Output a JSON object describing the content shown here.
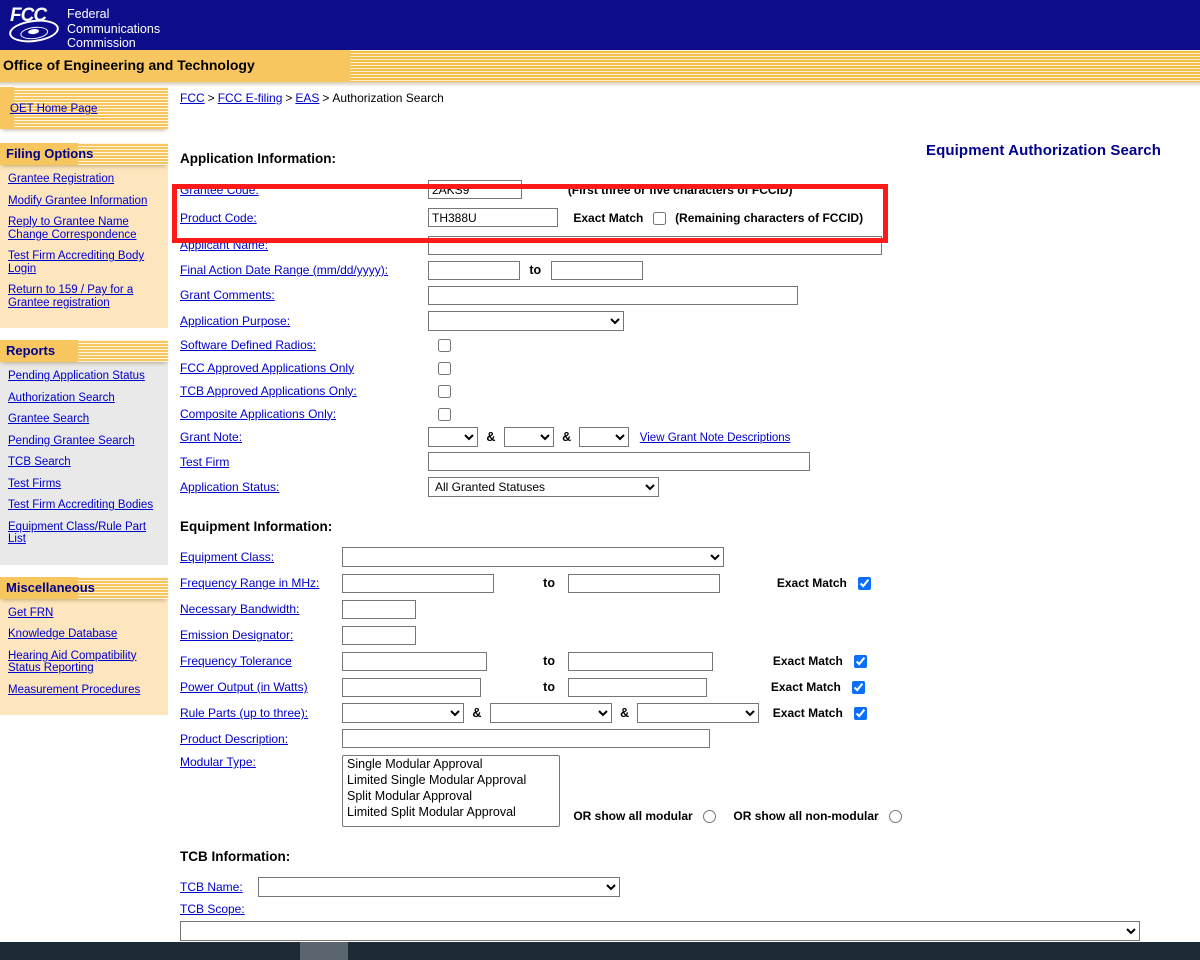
{
  "header": {
    "agency_abbr": "FCC",
    "agency_name_lines": "Federal\nCommunications\nCommission",
    "agency_line1": "Federal",
    "agency_line2": "Communications",
    "agency_line3": "Commission",
    "office_title": "Office of Engineering and Technology"
  },
  "breadcrumb": {
    "items": [
      "FCC",
      "FCC E-filing",
      "EAS"
    ],
    "current": "Authorization Search",
    "separator": ">"
  },
  "page_title": "Equipment Authorization Search",
  "sidebar": {
    "home_link": "OET Home Page",
    "panels": [
      {
        "title": "Filing Options",
        "style": "cream",
        "items": [
          "Grantee Registration",
          "Modify Grantee Information",
          "Reply to Grantee Name Change Correspondence",
          "Test Firm Accrediting Body Login",
          "Return to 159 / Pay for a Grantee registration"
        ]
      },
      {
        "title": "Reports",
        "style": "gray",
        "items": [
          "Pending Application Status",
          "Authorization Search",
          "Grantee Search",
          "Pending Grantee Search",
          "TCB Search",
          "Test Firms",
          "Test Firm Accrediting Bodies",
          "Equipment Class/Rule Part List"
        ]
      },
      {
        "title": "Miscellaneous",
        "style": "cream",
        "items": [
          "Get FRN",
          "Knowledge Database",
          "Hearing Aid Compatibility Status Reporting",
          "Measurement Procedures"
        ]
      }
    ]
  },
  "application_information": {
    "section_label": "Application Information:",
    "grantee_code": {
      "label": "Grantee Code:",
      "value": "2AKS9",
      "hint": "(First three or five characters of FCCID)"
    },
    "product_code": {
      "label": "Product Code:",
      "value": "TH388U",
      "exact_match_label": "Exact Match",
      "exact_match_checked": false,
      "hint": "(Remaining characters of FCCID)"
    },
    "applicant_name": {
      "label": "Applicant Name:",
      "value": ""
    },
    "final_action_date_range": {
      "label": "Final Action Date Range (mm/dd/yyyy):",
      "from": "",
      "to": "",
      "to_label": "to"
    },
    "grant_comments": {
      "label": "Grant Comments:",
      "value": ""
    },
    "application_purpose": {
      "label": "Application Purpose:",
      "selected": ""
    },
    "software_defined_radios": {
      "label": "Software Defined Radios:",
      "checked": false
    },
    "fcc_approved_only": {
      "label": "FCC Approved Applications Only",
      "checked": false
    },
    "tcb_approved_only": {
      "label": "TCB Approved Applications Only:",
      "checked": false
    },
    "composite_only": {
      "label": "Composite Applications Only:",
      "checked": false
    },
    "grant_note": {
      "label": "Grant Note:",
      "selected1": "",
      "selected2": "",
      "selected3": "",
      "amp": "&",
      "link": "View Grant Note Descriptions"
    },
    "test_firm": {
      "label": "Test Firm",
      "value": ""
    },
    "application_status": {
      "label": "Application Status:",
      "selected": "All Granted Statuses"
    }
  },
  "equipment_information": {
    "section_label": "Equipment Information:",
    "equipment_class": {
      "label": "Equipment Class:",
      "selected": ""
    },
    "frequency_range": {
      "label": "Frequency Range in MHz:",
      "from": "",
      "to": "",
      "to_label": "to",
      "exact_match_label": "Exact Match",
      "exact_match_checked": true
    },
    "necessary_bandwidth": {
      "label": "Necessary Bandwidth:",
      "value": ""
    },
    "emission_designator": {
      "label": "Emission Designator:",
      "value": ""
    },
    "frequency_tolerance": {
      "label": "Frequency Tolerance",
      "from": "",
      "to": "",
      "to_label": "to",
      "exact_match_label": "Exact Match",
      "exact_match_checked": true
    },
    "power_output": {
      "label": "Power Output (in Watts)",
      "from": "",
      "to": "",
      "to_label": "to",
      "exact_match_label": "Exact Match",
      "exact_match_checked": true
    },
    "rule_parts": {
      "label": "Rule Parts (up to three):",
      "selected1": "",
      "selected2": "",
      "selected3": "",
      "amp": "&",
      "exact_match_label": "Exact Match",
      "exact_match_checked": true
    },
    "product_description": {
      "label": "Product Description:",
      "value": ""
    },
    "modular_type": {
      "label": "Modular Type:",
      "options": [
        "Single Modular Approval",
        "Limited Single Modular Approval",
        "Split Modular Approval",
        "Limited Split Modular Approval"
      ],
      "or_modular_label": "OR show all modular",
      "or_modular_selected": false,
      "or_nonmodular_label": "OR show all non-modular",
      "or_nonmodular_selected": false,
      "or_prefix": "OR"
    }
  },
  "tcb_information": {
    "section_label": "TCB Information:",
    "tcb_name": {
      "label": "TCB Name:",
      "selected": ""
    },
    "tcb_scope": {
      "label": "TCB Scope:",
      "selected": ""
    }
  },
  "colors": {
    "banner_blue": "#0d0d8c",
    "band_gold": "#f8c65e",
    "panel_cream": "#fde5bd",
    "panel_gray": "#e9e9e9",
    "link_blue": "#0000cc",
    "title_navy": "#00008b",
    "highlight_red": "#ff1a1a",
    "checkbox_blue": "#0b6ffb"
  }
}
